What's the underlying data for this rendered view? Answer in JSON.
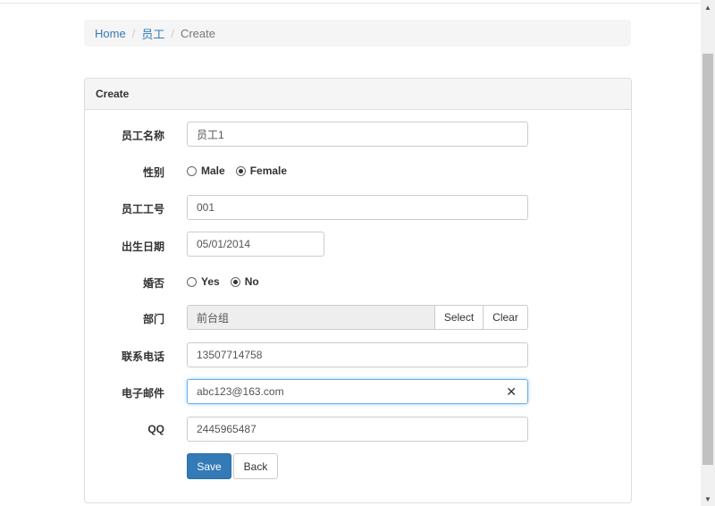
{
  "breadcrumb": {
    "home": "Home",
    "section": "员工",
    "current": "Create"
  },
  "panel": {
    "title": "Create"
  },
  "form": {
    "name": {
      "label": "员工名称",
      "value": "员工1"
    },
    "gender": {
      "label": "性别",
      "options": [
        "Male",
        "Female"
      ],
      "selected": "Female"
    },
    "employee_no": {
      "label": "员工工号",
      "value": "001"
    },
    "birth_date": {
      "label": "出生日期",
      "value": "05/01/2014"
    },
    "married": {
      "label": "婚否",
      "options": [
        "Yes",
        "No"
      ],
      "selected": "No"
    },
    "department": {
      "label": "部门",
      "value": "前台组",
      "select_label": "Select",
      "clear_label": "Clear"
    },
    "phone": {
      "label": "联系电话",
      "value": "13507714758"
    },
    "email": {
      "label": "电子邮件",
      "value": "abc123@163.com",
      "clear_glyph": "✕"
    },
    "qq": {
      "label": "QQ",
      "value": "2445965487"
    }
  },
  "actions": {
    "save": "Save",
    "back": "Back"
  },
  "colors": {
    "primary": "#337ab7",
    "link": "#337ab7"
  },
  "icons": {
    "clear": "close-icon",
    "scroll_up": "chevron-up-icon",
    "scroll_down": "chevron-down-icon"
  }
}
